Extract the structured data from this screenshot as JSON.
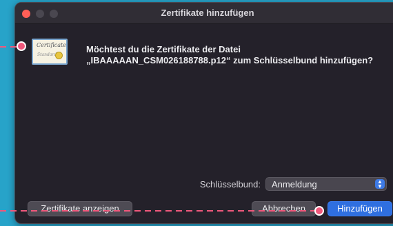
{
  "dialog": {
    "title": "Zertifikate hinzufügen",
    "message": "Möchtest du die Zertifikate der Datei „IBAAAAAN_CSM026188788.p12“ zum Schlüsselbund hinzufügen?",
    "keychain_label": "Schlüsselbund:",
    "keychain_value": "Anmeldung",
    "buttons": {
      "show_certificates": "Zertifikate anzeigen",
      "cancel": "Abbrechen",
      "add": "Hinzufügen"
    }
  },
  "certificate_icon": {
    "title_text": "Certificate",
    "subtitle_text": "Standard"
  },
  "colors": {
    "background": "#27a3c9",
    "window": "#24212a",
    "primary_button": "#2f6fe0",
    "annotation": "#f0587c"
  }
}
